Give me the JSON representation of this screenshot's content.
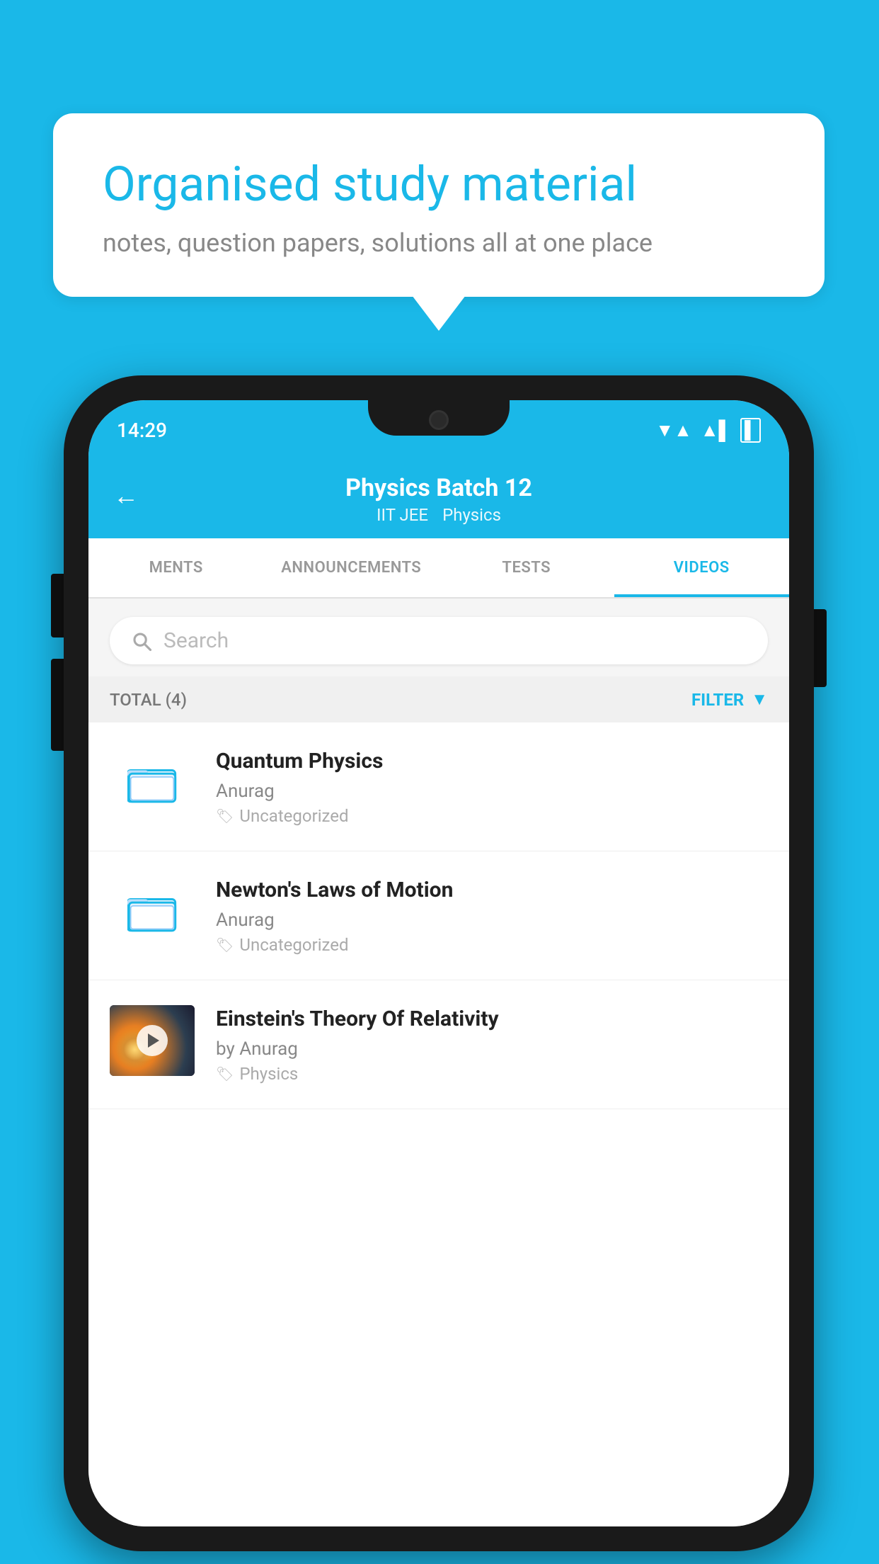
{
  "background_color": "#1ab8e8",
  "bubble": {
    "title": "Organised study material",
    "subtitle": "notes, question papers, solutions all at one place"
  },
  "status_bar": {
    "time": "14:29",
    "wifi": "▼",
    "signal": "▲",
    "battery": "▌"
  },
  "header": {
    "title": "Physics Batch 12",
    "subtitle1": "IIT JEE",
    "subtitle2": "Physics",
    "back_label": "←"
  },
  "tabs": [
    {
      "label": "MENTS",
      "active": false
    },
    {
      "label": "ANNOUNCEMENTS",
      "active": false
    },
    {
      "label": "TESTS",
      "active": false
    },
    {
      "label": "VIDEOS",
      "active": true
    }
  ],
  "search": {
    "placeholder": "Search"
  },
  "filter": {
    "total_label": "TOTAL (4)",
    "filter_label": "FILTER"
  },
  "videos": [
    {
      "type": "folder",
      "title": "Quantum Physics",
      "author": "Anurag",
      "tag": "Uncategorized",
      "has_thumb": false
    },
    {
      "type": "folder",
      "title": "Newton's Laws of Motion",
      "author": "Anurag",
      "tag": "Uncategorized",
      "has_thumb": false
    },
    {
      "type": "video",
      "title": "Einstein's Theory Of Relativity",
      "author": "by Anurag",
      "tag": "Physics",
      "has_thumb": true
    }
  ]
}
